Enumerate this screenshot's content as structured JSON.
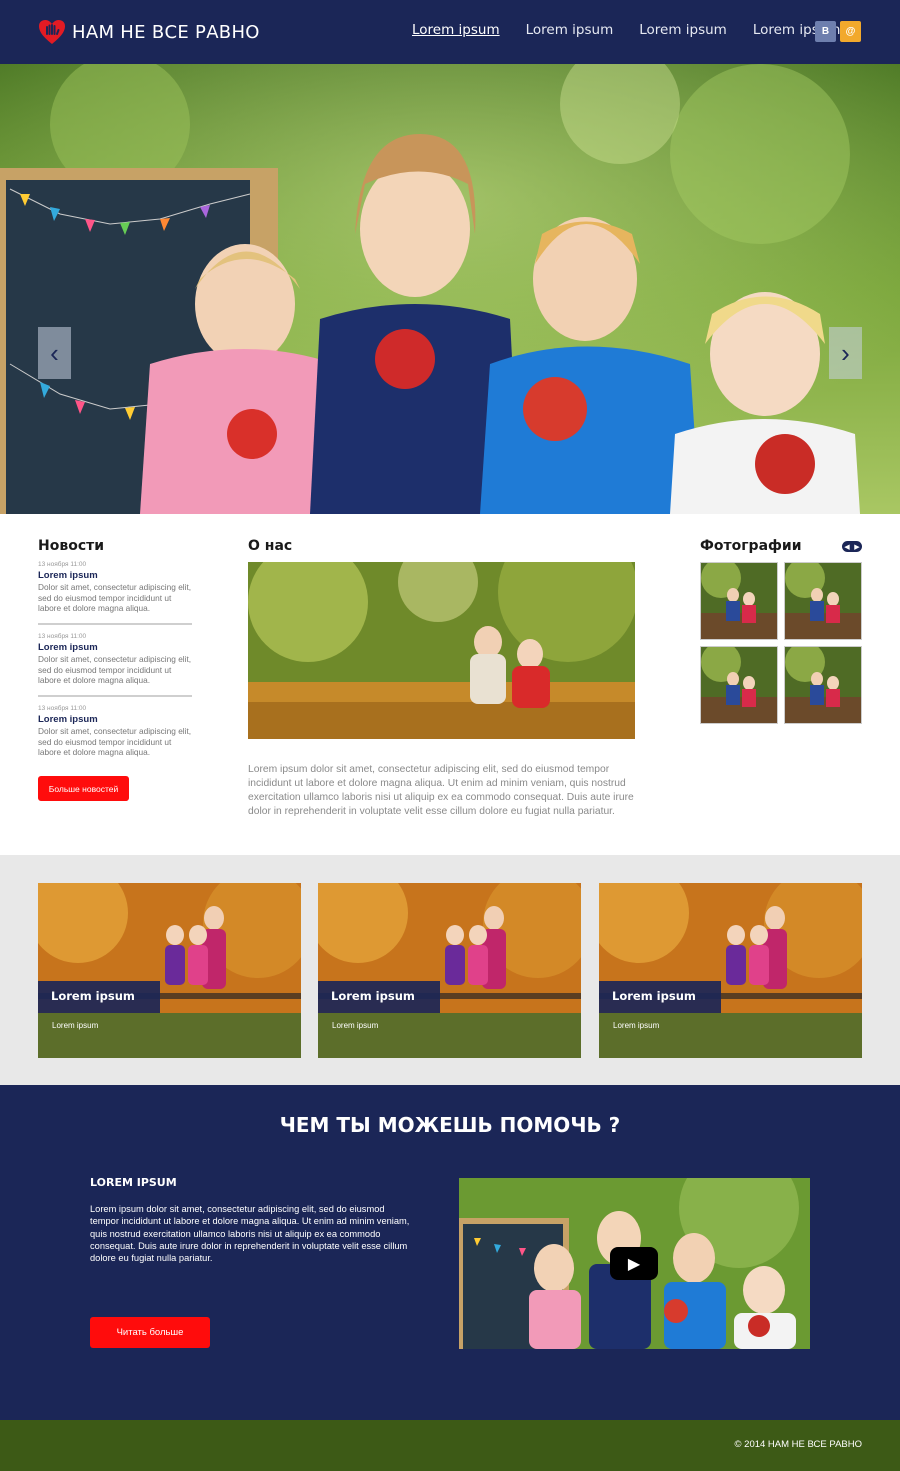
{
  "header": {
    "logo_text": "НАМ НЕ ВСЕ РАВНО",
    "nav": [
      "Lorem ipsum",
      "Lorem ipsum",
      "Lorem ipsum",
      "Lorem ipsum"
    ],
    "social": {
      "vk": "В",
      "mail": "@"
    }
  },
  "hero": {
    "prev": "‹",
    "next": "›"
  },
  "news": {
    "title": "Новости",
    "items": [
      {
        "date": "13 ноября 11:00",
        "title": "Lorem ipsum",
        "text": "Dolor sit amet, consectetur adipiscing elit, sed do eiusmod tempor incididunt ut labore et dolore magna aliqua."
      },
      {
        "date": "13 ноября 11:00",
        "title": "Lorem ipsum",
        "text": "Dolor sit amet, consectetur adipiscing elit, sed do eiusmod tempor incididunt ut labore et dolore magna aliqua."
      },
      {
        "date": "13 ноября 11:00",
        "title": "Lorem ipsum",
        "text": "Dolor sit amet, consectetur adipiscing elit, sed do eiusmod tempor incididunt ut labore et dolore magna aliqua."
      }
    ],
    "more_button": "Больше новостей"
  },
  "about": {
    "title": "О нас",
    "text": "Lorem ipsum dolor sit amet, consectetur adipiscing elit, sed do eiusmod tempor incididunt ut labore et dolore magna aliqua. Ut enim ad minim veniam, quis nostrud exercitation ullamco laboris nisi ut aliquip ex ea commodo consequat. Duis aute irure dolor in reprehenderit in voluptate velit esse cillum dolore eu fugiat nulla pariatur."
  },
  "photos": {
    "title": "Фотографии"
  },
  "cards": [
    {
      "title": "Lorem ipsum",
      "sub": "Lorem ipsum"
    },
    {
      "title": "Lorem ipsum",
      "sub": "Lorem ipsum"
    },
    {
      "title": "Lorem ipsum",
      "sub": "Lorem ipsum"
    }
  ],
  "help": {
    "title": "ЧЕМ ТЫ МОЖЕШЬ ПОМОЧЬ ?",
    "subtitle": "LOREM IPSUM",
    "text": "Lorem ipsum dolor sit amet, consectetur adipiscing elit, sed do eiusmod tempor incididunt ut labore et dolore magna aliqua. Ut enim ad minim veniam, quis nostrud exercitation ullamco laboris nisi ut aliquip ex ea commodo consequat. Duis aute irure dolor in reprehenderit in voluptate velit esse cillum dolore eu fugiat nulla pariatur.",
    "button": "Читать больше"
  },
  "footer": {
    "copyright": "© 2014 НАМ НЕ ВСЕ РАВНО"
  },
  "colors": {
    "navy": "#1b2657",
    "red": "#ff0c0c",
    "green": "#3d5a16",
    "gray": "#e8e8e8"
  }
}
